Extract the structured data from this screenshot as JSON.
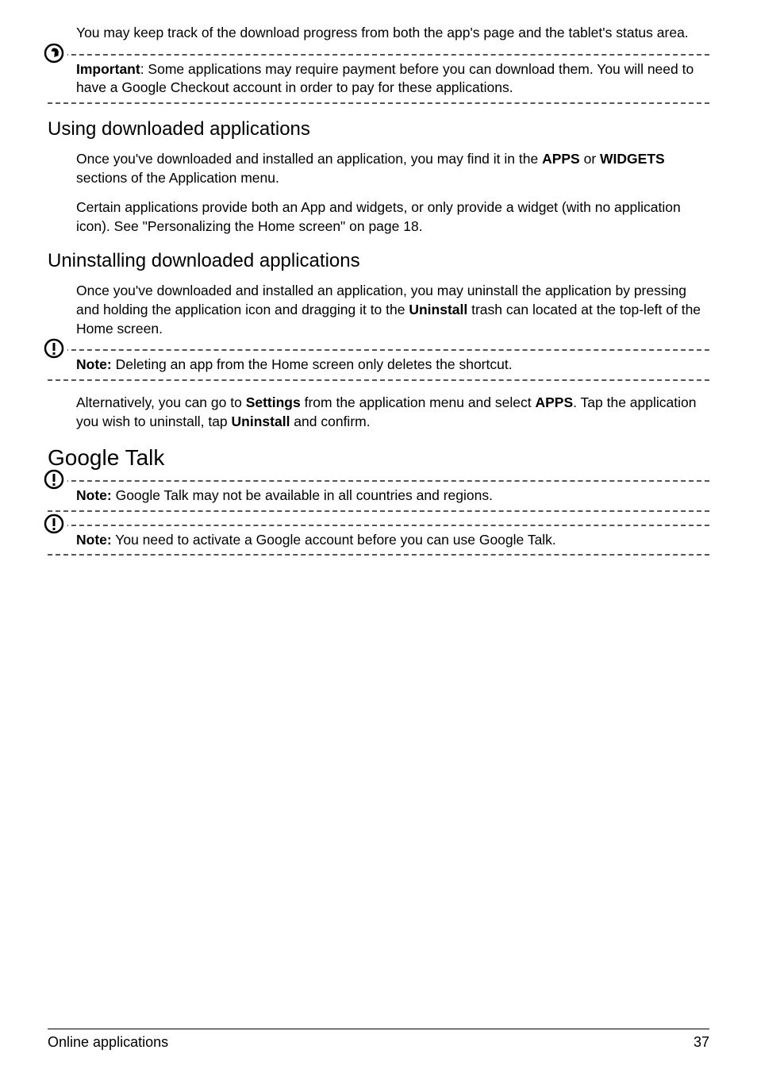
{
  "intro": {
    "p1": "You may keep track of the download progress from both the app's page and the tablet's status area."
  },
  "callouts": {
    "important1_label": "Important",
    "important1_text": ": Some applications may require payment before you can download them. You will need to have a Google Checkout account in order to pay for these applications.",
    "note_delete_label": "Note:",
    "note_delete_text": " Deleting an app from the Home screen only deletes the shortcut.",
    "note_gtalk1_label": "Note:",
    "note_gtalk1_text": " Google Talk may not be available in all countries and regions.",
    "note_gtalk2_label": "Note:",
    "note_gtalk2_text": " You need to activate a Google account before you can use Google Talk."
  },
  "sections": {
    "using_apps": {
      "heading": "Using downloaded applications",
      "p1_a": "Once you've downloaded and installed an application, you may find it in the ",
      "p1_b": "APPS",
      "p1_c": " or ",
      "p1_d": "WIDGETS",
      "p1_e": " sections of the Application menu.",
      "p2": "Certain applications provide both an App and widgets, or only provide a widget (with no application icon). See \"Personalizing the Home screen\" on page 18."
    },
    "uninstall": {
      "heading": "Uninstalling downloaded applications",
      "p1_a": "Once you've downloaded and installed an application, you may uninstall the application by pressing and holding the application icon and dragging it to the ",
      "p1_b": "Uninstall",
      "p1_c": " trash can located at the top-left of the Home screen.",
      "p2_a": "Alternatively, you can go to ",
      "p2_b": "Settings",
      "p2_c": " from the application menu and select ",
      "p2_d": "APPS",
      "p2_e": ". Tap the application you wish to uninstall, tap ",
      "p2_f": "Uninstall",
      "p2_g": " and confirm."
    },
    "gtalk": {
      "heading": "Google Talk"
    }
  },
  "footer": {
    "left": "Online applications",
    "right": "37"
  }
}
